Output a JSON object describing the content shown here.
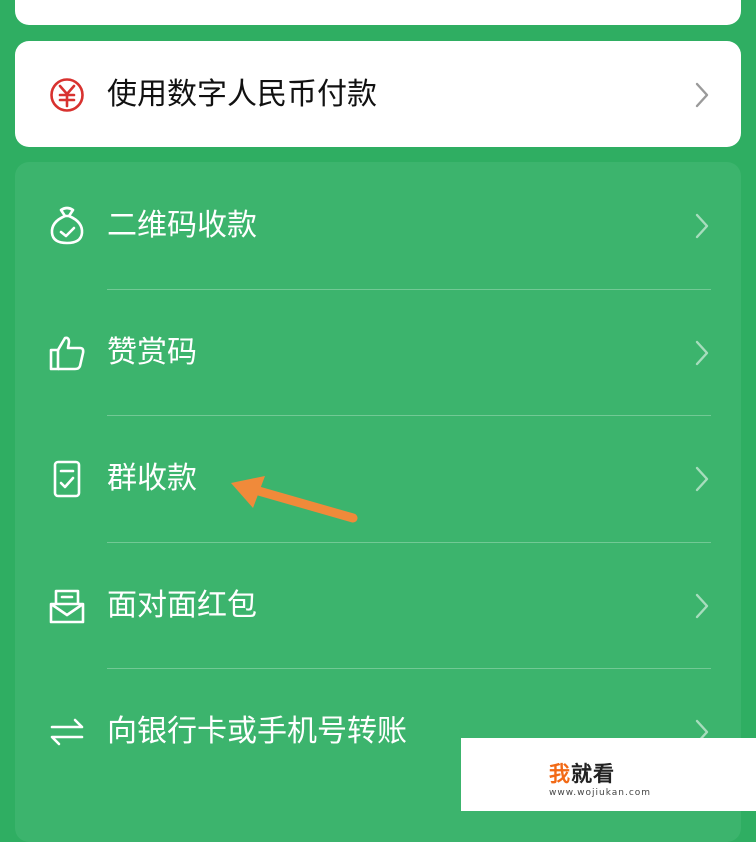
{
  "pay_card": {
    "label": "使用数字人民币付款",
    "icon": "yuan-coin-icon"
  },
  "menu": {
    "items": [
      {
        "label": "二维码收款",
        "icon": "money-bag-icon"
      },
      {
        "label": "赞赏码",
        "icon": "thumbs-up-icon"
      },
      {
        "label": "群收款",
        "icon": "receipt-icon"
      },
      {
        "label": "面对面红包",
        "icon": "red-packet-icon"
      },
      {
        "label": "向银行卡或手机号转账",
        "icon": "transfer-arrows-icon"
      }
    ]
  },
  "annotation": {
    "arrow_color": "#f08a3a",
    "points_to": "群收款"
  },
  "watermark": {
    "title_accent": "我",
    "title_rest": "就看",
    "url": "www.wojiukan.com"
  },
  "colors": {
    "background": "#2fae62",
    "menu_card": "#3cb46d",
    "pay_icon": "#d8322f",
    "watermark_accent": "#f26a16"
  }
}
